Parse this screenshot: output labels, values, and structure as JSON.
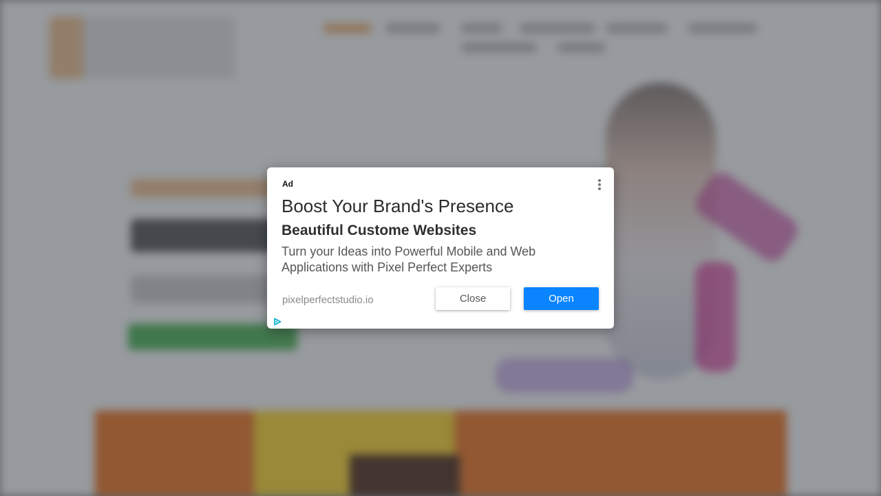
{
  "ad": {
    "label": "Ad",
    "headline": "Boost Your Brand's Presence",
    "subheadline": "Beautiful Custome Websites",
    "body": "Turn your Ideas into Powerful Mobile and Web Applications with Pixel Perfect Experts",
    "display_url": "pixelperfectstudio.io",
    "close_label": "Close",
    "open_label": "Open",
    "menu_icon": "more-vert-icon",
    "adchoices_icon": "adchoices-icon"
  },
  "colors": {
    "open_button": "#0a84ff",
    "overlay": "rgba(40,46,56,0.45)",
    "adchoices": "#00aecd"
  }
}
